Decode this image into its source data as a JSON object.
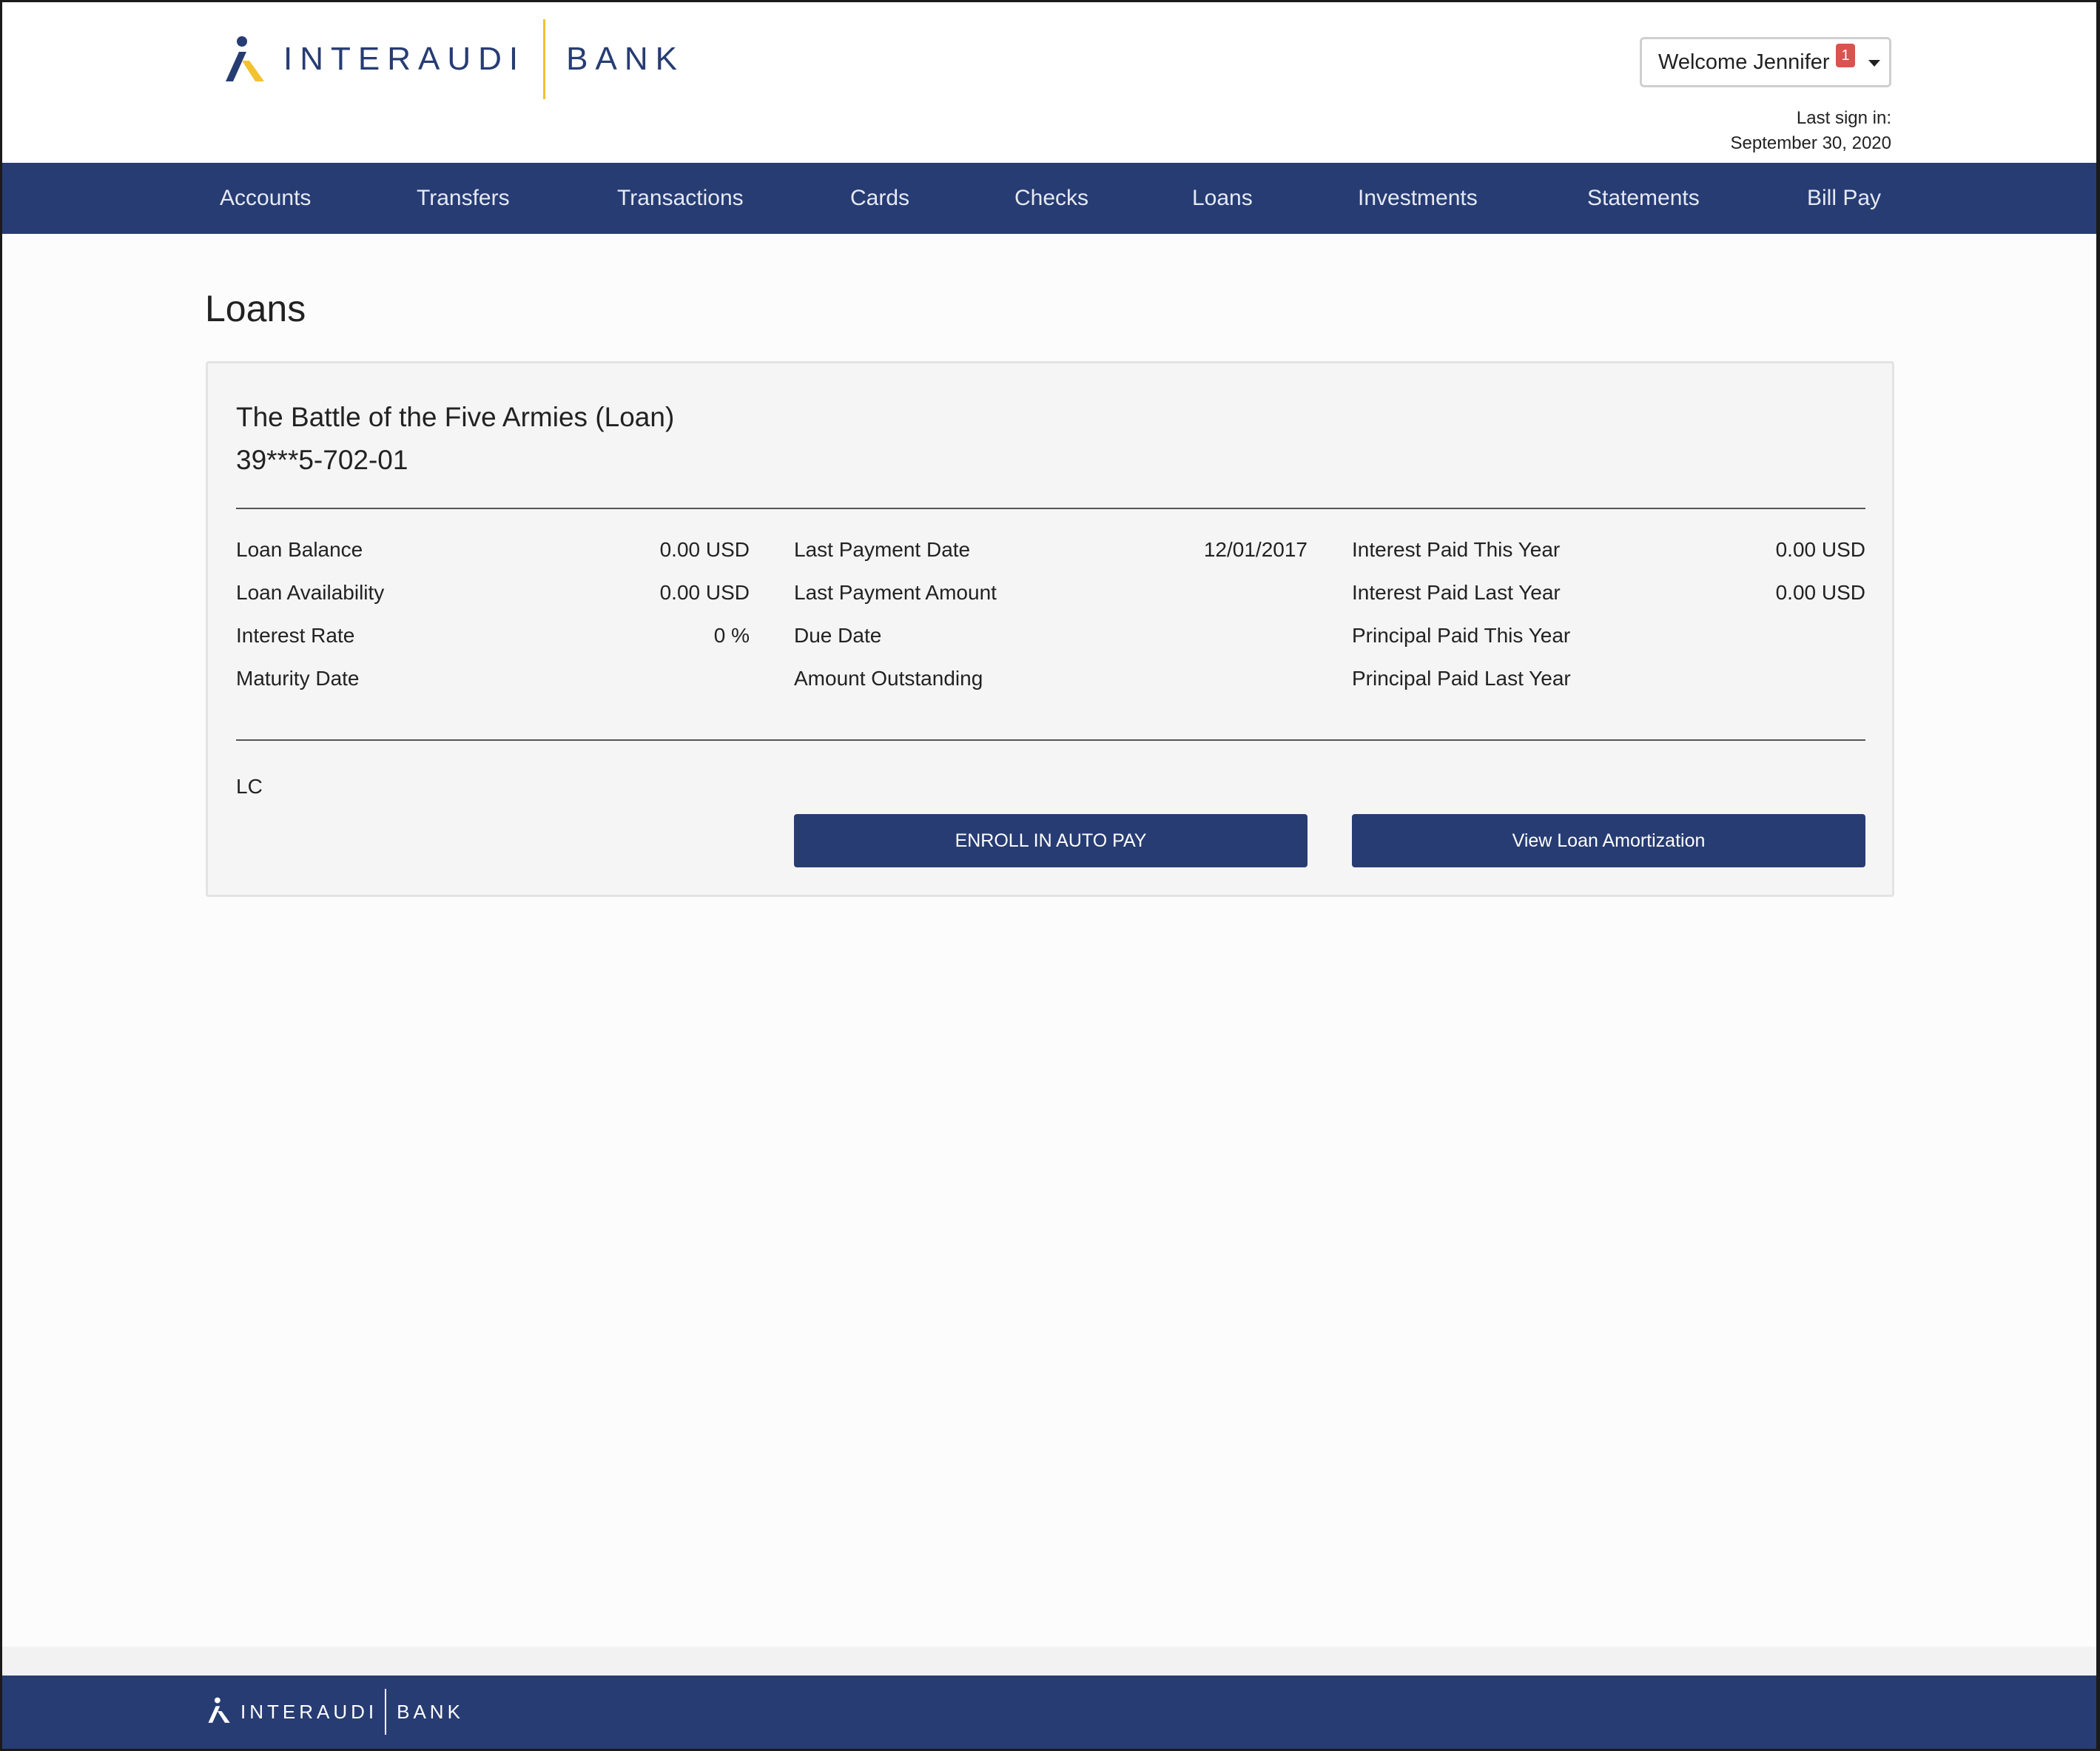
{
  "brand": {
    "name": "INTERAUDI",
    "suffix": "BANK",
    "primary_color": "#273c73",
    "accent_color": "#f2c230"
  },
  "header": {
    "welcome_label": "Welcome Jennifer",
    "notification_count": "1",
    "last_sign_in_label": "Last sign in:",
    "last_sign_in_date": "September 30, 2020"
  },
  "nav": {
    "items": [
      {
        "label": "Accounts"
      },
      {
        "label": "Transfers"
      },
      {
        "label": "Transactions"
      },
      {
        "label": "Cards"
      },
      {
        "label": "Checks"
      },
      {
        "label": "Loans"
      },
      {
        "label": "Investments"
      },
      {
        "label": "Statements"
      },
      {
        "label": "Bill Pay"
      }
    ]
  },
  "page": {
    "title": "Loans"
  },
  "loan": {
    "name": "The Battle of the Five Armies (Loan)",
    "number": "39***5-702-01",
    "columns": [
      [
        {
          "label": "Loan Balance",
          "value": "0.00 USD"
        },
        {
          "label": "Loan Availability",
          "value": "0.00 USD"
        },
        {
          "label": "Interest Rate",
          "value": "0 %"
        },
        {
          "label": "Maturity Date",
          "value": ""
        }
      ],
      [
        {
          "label": "Last Payment Date",
          "value": "12/01/2017"
        },
        {
          "label": "Last Payment Amount",
          "value": ""
        },
        {
          "label": "Due Date",
          "value": ""
        },
        {
          "label": "Amount Outstanding",
          "value": ""
        }
      ],
      [
        {
          "label": "Interest Paid This Year",
          "value": "0.00 USD"
        },
        {
          "label": "Interest Paid Last Year",
          "value": "0.00 USD"
        },
        {
          "label": "Principal Paid This Year",
          "value": ""
        },
        {
          "label": "Principal Paid Last Year",
          "value": ""
        }
      ]
    ],
    "type_code": "LC",
    "enroll_label": "ENROLL IN AUTO PAY",
    "amortization_label": "View Loan Amortization"
  },
  "footer": {
    "name": "INTERAUDI",
    "suffix": "BANK"
  }
}
